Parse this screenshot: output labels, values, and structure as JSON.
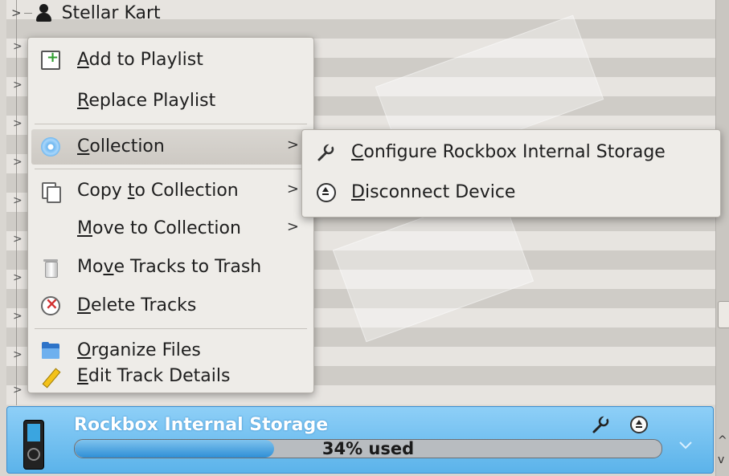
{
  "tree": {
    "first_item": "Stellar Kart"
  },
  "context_menu": {
    "items": [
      {
        "label_pre": "",
        "mnemonic": "A",
        "label_post": "dd to Playlist",
        "icon": "add-to-playlist-icon"
      },
      {
        "label_pre": "",
        "mnemonic": "R",
        "label_post": "eplace Playlist",
        "icon": ""
      },
      {
        "label_pre": "",
        "mnemonic": "C",
        "label_post": "ollection",
        "icon": "collection-cd-icon",
        "submenu_arrow": ">"
      },
      {
        "label_pre": "Copy ",
        "mnemonic": "t",
        "label_post": "o Collection",
        "icon": "copy-icon",
        "submenu_arrow": ">"
      },
      {
        "label_pre": "",
        "mnemonic": "M",
        "label_post": "ove to Collection",
        "icon": "",
        "submenu_arrow": ">"
      },
      {
        "label_pre": "Mo",
        "mnemonic": "v",
        "label_post": "e Tracks to Trash",
        "icon": "trash-icon"
      },
      {
        "label_pre": "",
        "mnemonic": "D",
        "label_post": "elete Tracks",
        "icon": "delete-icon"
      },
      {
        "label_pre": "",
        "mnemonic": "O",
        "label_post": "rganize Files",
        "icon": "folder-icon"
      },
      {
        "label_pre": "",
        "mnemonic": "E",
        "label_post": "dit Track Details",
        "icon": "pencil-icon"
      }
    ]
  },
  "collection_submenu": {
    "items": [
      {
        "label_pre": "",
        "mnemonic": "C",
        "label_post": "onfigure Rockbox Internal Storage",
        "icon": "wrench-icon"
      },
      {
        "label_pre": "",
        "mnemonic": "D",
        "label_post": "isconnect Device",
        "icon": "eject-icon"
      }
    ]
  },
  "device_bar": {
    "name": "Rockbox Internal Storage",
    "usage_text": "34% used",
    "usage_fraction": 0.34,
    "accent_color": "#5bb3ea"
  },
  "scrollbar": {
    "up_arrow": "^",
    "down_arrow": "v"
  }
}
